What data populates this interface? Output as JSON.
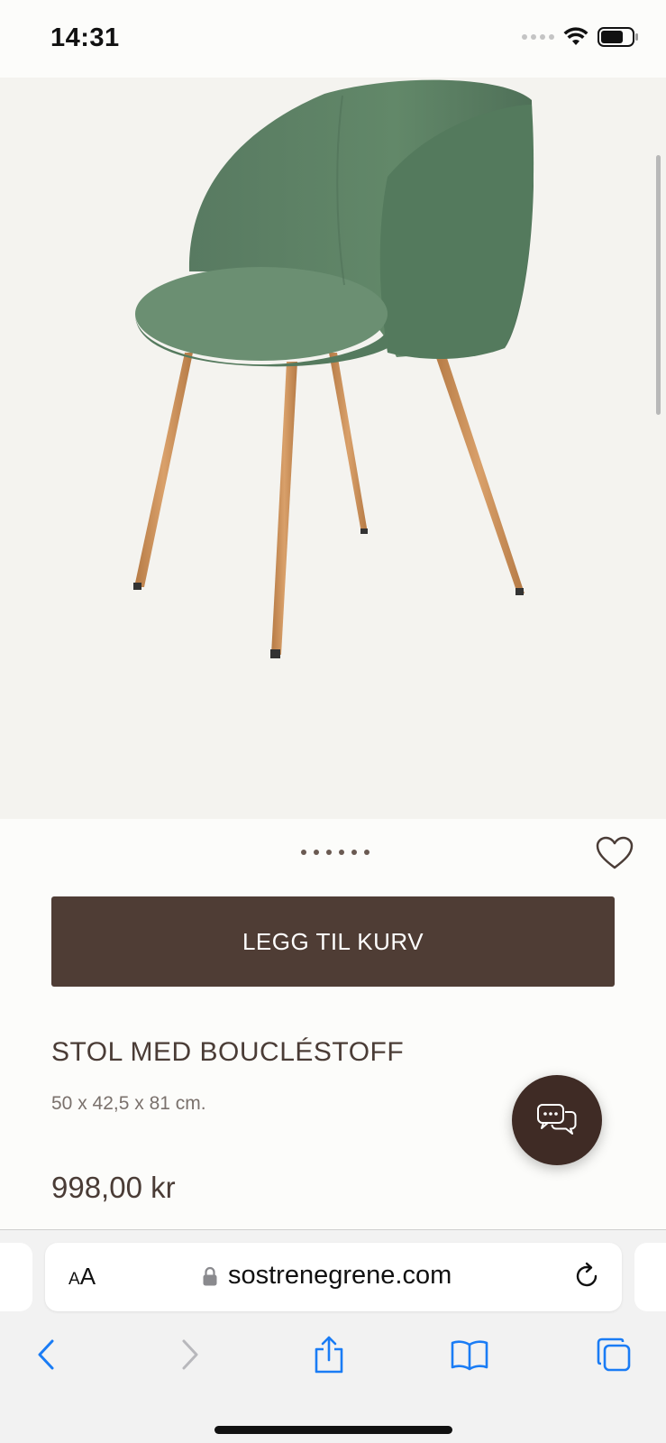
{
  "status_bar": {
    "time": "14:31"
  },
  "product": {
    "image_count": 6,
    "add_to_cart_label": "LEGG TIL KURV",
    "title": "STOL MED BOUCLÉSTOFF",
    "dimensions": "50 x 42,5 x 81 cm.",
    "price": "998,00 kr"
  },
  "browser": {
    "text_size_label_small": "A",
    "text_size_label_large": "A",
    "url": "sostrenegrene.com"
  },
  "icons": {
    "wishlist": "heart-icon",
    "chat": "chat-bubbles-icon",
    "lock": "lock-icon",
    "reload": "reload-icon",
    "back": "chevron-left-icon",
    "forward": "chevron-right-icon",
    "share": "share-icon",
    "bookmarks": "book-icon",
    "tabs": "tabs-icon"
  },
  "colors": {
    "button_bg": "#4f3d35",
    "chat_bg": "#3f2b25",
    "text_dark": "#4a3c36",
    "ios_blue": "#1a7cf5",
    "chair_green": "#5c7f65",
    "chair_legs": "#c98d55"
  }
}
